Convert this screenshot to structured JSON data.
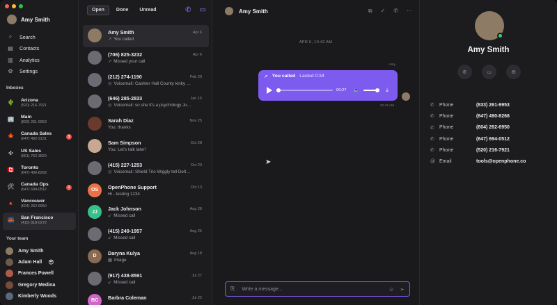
{
  "sidebar": {
    "user": {
      "name": "Amy Smith"
    },
    "nav": [
      {
        "label": "Search",
        "icon": "search-icon"
      },
      {
        "label": "Contacts",
        "icon": "contacts-icon"
      },
      {
        "label": "Analytics",
        "icon": "analytics-icon"
      },
      {
        "label": "Settings",
        "icon": "settings-icon"
      }
    ],
    "inboxes_header": "Inboxes",
    "inboxes": [
      {
        "name": "Arizona",
        "number": "(520) 216-7921",
        "flag": "🌵",
        "badge": ""
      },
      {
        "name": "Main",
        "number": "(833) 261-9953",
        "flag": "🏢",
        "badge": ""
      },
      {
        "name": "Canada Sales",
        "number": "(647) 492-3131",
        "flag": "🍁",
        "badge": "3"
      },
      {
        "name": "US Sales",
        "number": "(661) 762-3829",
        "flag": "✣",
        "badge": ""
      },
      {
        "name": "Toronto",
        "number": "(647) 490-8268",
        "flag": "🇨🇦",
        "badge": ""
      },
      {
        "name": "Canada Ops",
        "number": "(647) 694-0512",
        "flag": "🛠",
        "badge": "1"
      },
      {
        "name": "Vancouver",
        "number": "(604) 262-6950",
        "flag": "🔺",
        "badge": ""
      },
      {
        "name": "San Francisco",
        "number": "(415) 818-0272",
        "flag": "🌉",
        "badge": ""
      }
    ],
    "team_header": "Your team",
    "team": [
      {
        "name": "Amy Smith",
        "color": "#8d7b66",
        "emoji": ""
      },
      {
        "name": "Adam Hall",
        "color": "#6d5a4a",
        "emoji": "😎"
      },
      {
        "name": "Frances Powell",
        "color": "#b05a48",
        "emoji": ""
      },
      {
        "name": "Gregory Medina",
        "color": "#7a4a3a",
        "emoji": ""
      },
      {
        "name": "Kimberly Woods",
        "color": "#5a6a7a",
        "emoji": ""
      }
    ]
  },
  "list": {
    "tabs": [
      "Open",
      "Done",
      "Unread"
    ],
    "active_tab": "Open",
    "conversations": [
      {
        "name": "Amy Smith",
        "preview": "You called",
        "picon": "↗",
        "date": "Apr 6",
        "initials": "",
        "color": "#8d7b66"
      },
      {
        "name": "(706) 825-3232",
        "preview": "Missed your call",
        "picon": "↗",
        "date": "Apr 6",
        "initials": "",
        "color": "#6b6b73"
      },
      {
        "name": "(212) 274-1190",
        "preview": "Voicemail: Cashier Hall County kinky …",
        "picon": "◎",
        "date": "Feb 20",
        "initials": "",
        "color": "#6b6b73"
      },
      {
        "name": "(646) 285-2833",
        "preview": "Voicemail: so she it's a psychology Ju…",
        "picon": "◎",
        "date": "Jan 15",
        "initials": "",
        "color": "#6b6b73"
      },
      {
        "name": "Sarah Diaz",
        "preview": "You: thanks",
        "picon": "",
        "date": "Nov 25",
        "initials": "",
        "color": "#6a3a2e"
      },
      {
        "name": "Sam Simpson",
        "preview": "You: Let's talk later!",
        "picon": "",
        "date": "Oct 28",
        "initials": "",
        "color": "#c8a890"
      },
      {
        "name": "(415) 227-1253",
        "preview": "Voicemail: Shield Trio Wiggly tell Delt…",
        "picon": "◎",
        "date": "Oct 20",
        "initials": "",
        "color": "#6b6b73"
      },
      {
        "name": "OpenPhone Support",
        "preview": "Hi - testing 1234",
        "picon": "",
        "date": "Oct 13",
        "initials": "OS",
        "color": "#e8734a"
      },
      {
        "name": "Jack Johnson",
        "preview": "Missed call",
        "picon": "↙",
        "date": "Aug 28",
        "initials": "JJ",
        "color": "#34c28a"
      },
      {
        "name": "(415) 249-1957",
        "preview": "Missed call",
        "picon": "↙",
        "date": "Aug 25",
        "initials": "",
        "color": "#6b6b73"
      },
      {
        "name": "Daryna Kulya",
        "preview": "Image",
        "picon": "▦",
        "date": "Aug 18",
        "initials": "D",
        "color": "#8a6a50"
      },
      {
        "name": "(917) 438-8591",
        "preview": "Missed call",
        "picon": "↙",
        "date": "Jul 27",
        "initials": "",
        "color": "#6b6b73"
      },
      {
        "name": "Barbra Coleman",
        "preview": "",
        "picon": "",
        "date": "Jul 22",
        "initials": "BC",
        "color": "#d266c8"
      }
    ]
  },
  "chat": {
    "title": "Amy Smith",
    "date_separator": "APR 6, 10:42 AM",
    "sender_label": "Amy",
    "call": {
      "label": "You called",
      "lasted": "Lasted 0:34",
      "time": "00:27",
      "progress": 0.0
    },
    "message_time": "10:42 AM",
    "composer_placeholder": "Write a message..."
  },
  "contact": {
    "name": "Amy Smith",
    "fields": [
      {
        "icon": "phone-icon",
        "key": "Phone",
        "value": "(833) 261-9953"
      },
      {
        "icon": "phone-icon",
        "key": "Phone",
        "value": "(647) 490-8268"
      },
      {
        "icon": "phone-icon",
        "key": "Phone",
        "value": "(604) 262-6950"
      },
      {
        "icon": "phone-icon",
        "key": "Phone",
        "value": "(647) 694-0512"
      },
      {
        "icon": "phone-icon",
        "key": "Phone",
        "value": "(520) 216-7921"
      },
      {
        "icon": "at-icon",
        "key": "Email",
        "value": "tools@openphone.co"
      }
    ]
  },
  "colors": {
    "accent": "#7e5bef",
    "online": "#3ccf6c",
    "badge": "#e5534b"
  }
}
